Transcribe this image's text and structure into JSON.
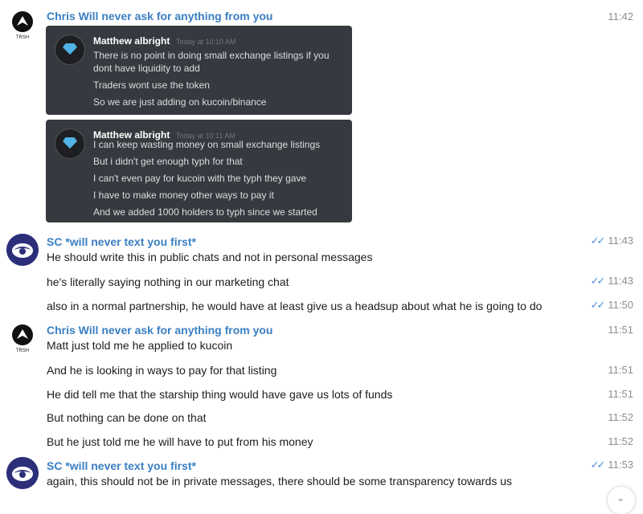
{
  "messages": [
    {
      "sender": "Chris Will never ask for anything from you",
      "time": "11:42",
      "screenshots": [
        {
          "author": "Matthew albright",
          "timestamp": "Today at 10:10 AM",
          "lines": [
            "There is no point in doing small exchange listings if you",
            "dont have liquidity to add",
            "Traders wont use the token",
            "So we are just adding on kucoin/binance"
          ]
        },
        {
          "author": "Matthew albright",
          "timestamp": "Today at 10:11 AM",
          "lines": [
            "I can keep wasting money on small exchange listings",
            "But i didn't get enough typh for that",
            "I can't even pay for kucoin with the typh they gave",
            "I have to make money other ways to pay it",
            "And we added 1000 holders to typh since we started"
          ]
        }
      ]
    },
    {
      "sender": "SC *will never text you first*",
      "lines": [
        {
          "text": "He should write this in public chats and not in personal messages",
          "time": "11:43"
        },
        {
          "text": "he's literally saying nothing in our marketing chat",
          "time": "11:43"
        },
        {
          "text": "also in a normal partnership, he would have at least give us a headsup about what he is going to do",
          "time": "11:50"
        }
      ]
    },
    {
      "sender": "Chris Will never ask for anything from you",
      "time": "11:51",
      "lines": [
        {
          "text": "Matt just told me he applied to kucoin"
        },
        {
          "text": "And he is looking in ways to pay for that listing",
          "time": "11:51"
        },
        {
          "text": "He did tell me that the starship thing would have gave us lots of funds",
          "time": "11:51"
        },
        {
          "text": "But nothing can be done on that",
          "time": "11:52"
        },
        {
          "text": "But he just told me he will have to put from his money",
          "time": "11:52"
        }
      ]
    },
    {
      "sender": "SC *will never text you first*",
      "lines": [
        {
          "text": "again, this should not be in private messages, there should be some transparency towards us",
          "time": "11:53"
        }
      ]
    }
  ],
  "icons": {
    "read_receipt": "double-check-icon",
    "scroll_down": "chevron-down-icon"
  },
  "colors": {
    "sender_name": "#3a7fc2",
    "read_ticks": "#4a8fd6",
    "discord_bg": "#36393f"
  }
}
